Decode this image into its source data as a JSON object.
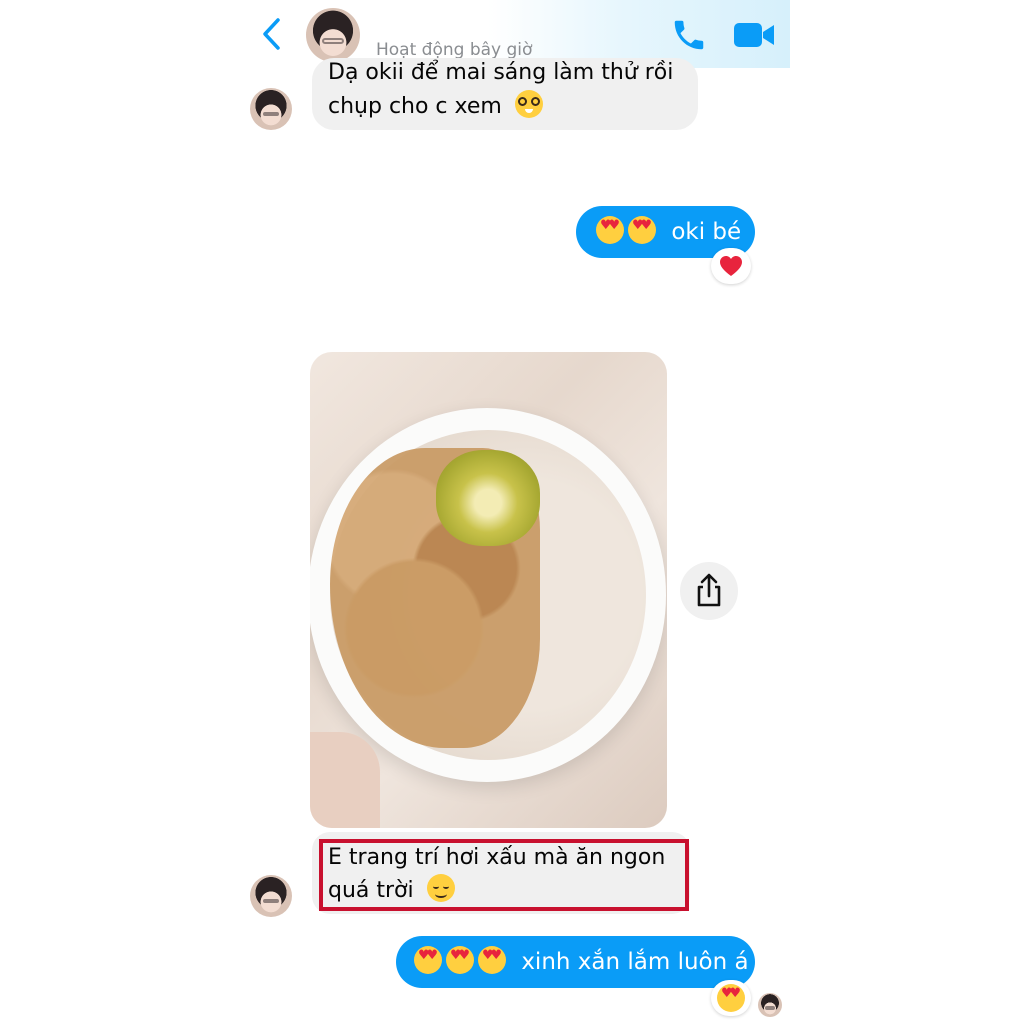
{
  "header": {
    "status": "Hoạt động bây giờ",
    "back_icon": "chevron-left-icon",
    "call_icon": "phone-icon",
    "video_icon": "video-camera-icon",
    "accent_color": "#0a9cf7"
  },
  "messages": [
    {
      "from": "them",
      "text_line1": "Dạ okii để mai sáng làm thử rồi",
      "text_line2": "chụp cho c xem",
      "emoji": "nerd-face"
    },
    {
      "from": "me",
      "emojis": [
        "heart-eyes",
        "heart-eyes"
      ],
      "text": "oki bé",
      "reaction": "red-heart"
    },
    {
      "from": "them",
      "type": "photo",
      "alt_icon": "share-icon"
    },
    {
      "from": "them",
      "text_line1": "E trang trí hơi xấu mà ăn ngon",
      "text_line2": "quá trời",
      "emoji": "smiling-face",
      "highlighted": true
    },
    {
      "from": "me",
      "emojis": [
        "heart-eyes",
        "heart-eyes",
        "heart-eyes"
      ],
      "text": "xinh xắn lắm luôn á",
      "reaction": "heart-eyes",
      "seen": true
    }
  ]
}
